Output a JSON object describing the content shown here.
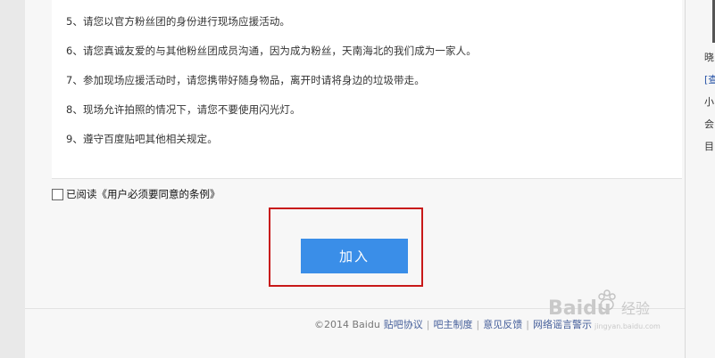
{
  "rules": [
    "5、请您以官方粉丝团的身份进行现场应援活动。",
    "6、请您真诚友爱的与其他粉丝团成员沟通，因为成为粉丝，天南海北的我们成为一家人。",
    "7、参加现场应援活动时，请您携带好随身物品，离开时请将身边的垃圾带走。",
    "8、现场允许拍照的情况下，请您不要使用闪光灯。",
    "9、遵守百度贴吧其他相关规定。"
  ],
  "agree": {
    "prefix": "已阅读",
    "link": "《用户必须要同意的条例》"
  },
  "join_button": "加入",
  "footer": {
    "copyright": "©2014 Baidu",
    "links": [
      "贴吧协议",
      "吧主制度",
      "意见反馈",
      "网络谣言警示"
    ]
  },
  "sidebar": {
    "items": [
      "晓",
      "[查",
      "小",
      "会",
      "目"
    ]
  },
  "watermark": {
    "brand": "Baidu",
    "text": "经验",
    "url": "jingyan.baidu.com"
  }
}
